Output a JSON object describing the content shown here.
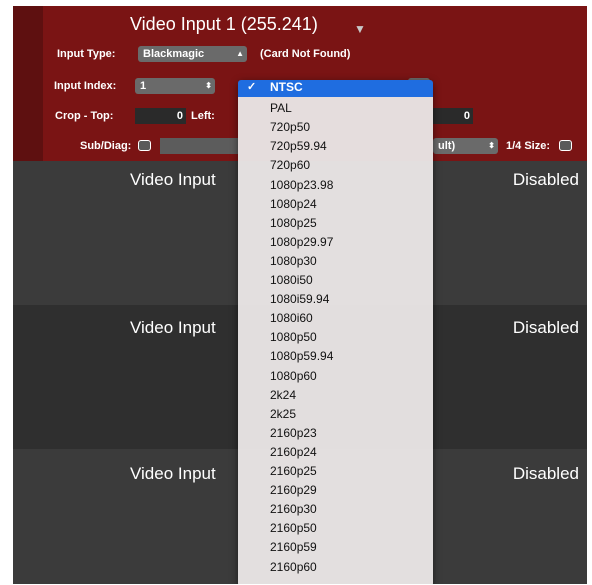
{
  "header": {
    "title": "Video Input 1 (255.241)",
    "input_type_label": "Input Type:",
    "input_type_value": "Blackmagic",
    "card_status": "(Card Not Found)",
    "input_index_label": "Input Index:",
    "input_index_value": "1",
    "crop_top_label": "Crop - Top:",
    "crop_top_value": "0",
    "crop_left_label": "Left:",
    "crop_right_value": "0",
    "sub_diag_label": "Sub/Diag:",
    "default_fragment": "ult)",
    "quarter_size_label": "1/4 Size:"
  },
  "rows": [
    {
      "title": "Video Input",
      "status": "Disabled"
    },
    {
      "title": "Video Input",
      "status": "Disabled"
    },
    {
      "title": "Video Input",
      "status": "Disabled"
    }
  ],
  "menu": {
    "selected": "NTSC",
    "check": "✓",
    "items": [
      "NTSC",
      "PAL",
      "720p50",
      "720p59.94",
      "720p60",
      "1080p23.98",
      "1080p24",
      "1080p25",
      "1080p29.97",
      "1080p30",
      "1080i50",
      "1080i59.94",
      "1080i60",
      "1080p50",
      "1080p59.94",
      "1080p60",
      "2k24",
      "2k25",
      "2160p23",
      "2160p24",
      "2160p25",
      "2160p29",
      "2160p30",
      "2160p50",
      "2160p59",
      "2160p60"
    ]
  },
  "colors": {
    "panel": "#7a1414",
    "background": "#3c3c3c",
    "selection": "#1f6de0"
  }
}
